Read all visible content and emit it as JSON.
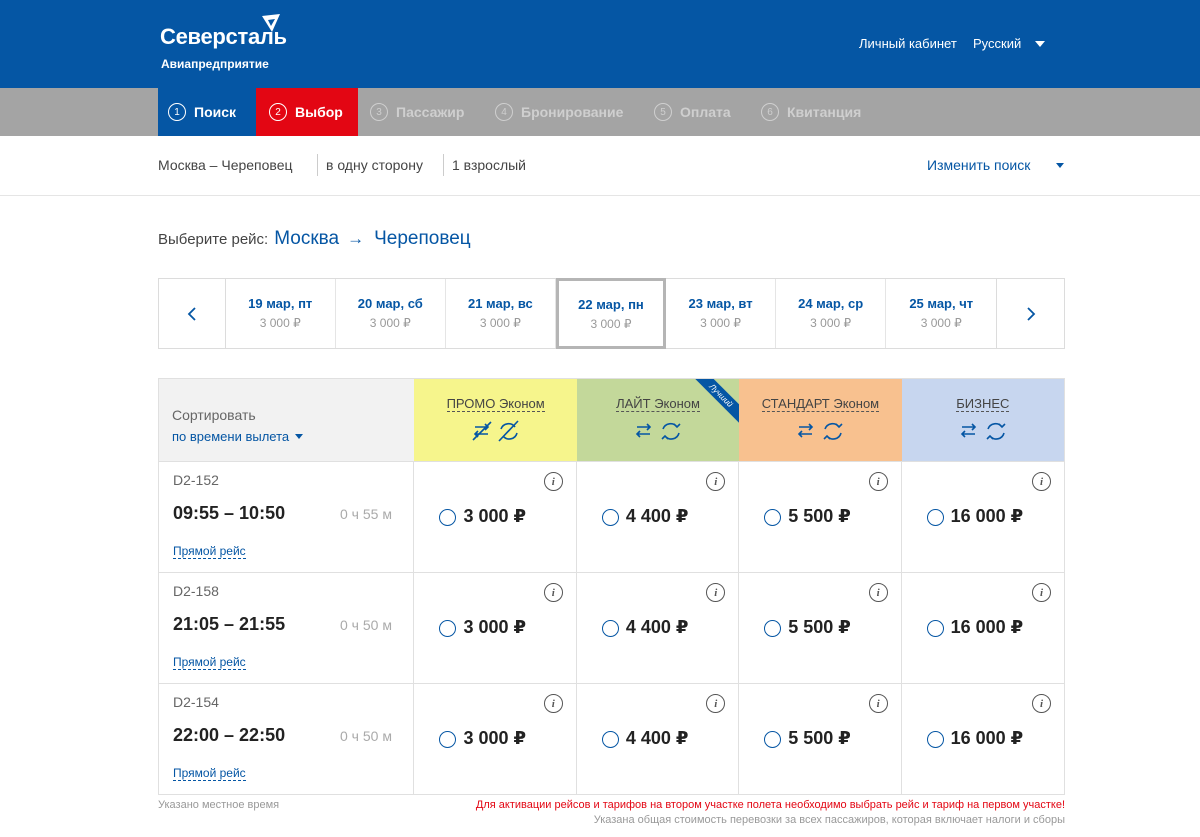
{
  "header": {
    "brand": "Северсталь",
    "subbrand": "Авиапредприятие",
    "account": "Личный кабинет",
    "language": "Русский",
    "colors": {
      "header": "#0556a4",
      "active_step": "#e30613"
    }
  },
  "steps": [
    {
      "num": "1",
      "label": "Поиск",
      "state": "done"
    },
    {
      "num": "2",
      "label": "Выбор",
      "state": "active"
    },
    {
      "num": "3",
      "label": "Пассажир",
      "state": "pending"
    },
    {
      "num": "4",
      "label": "Бронирование",
      "state": "pending"
    },
    {
      "num": "5",
      "label": "Оплата",
      "state": "pending"
    },
    {
      "num": "6",
      "label": "Квитанция",
      "state": "pending"
    }
  ],
  "summary": {
    "route": "Москва – Череповец",
    "trip_type": "в одну сторону",
    "passengers": "1 взрослый",
    "change": "Изменить поиск"
  },
  "choose": {
    "label": "Выберите рейс:",
    "from": "Москва",
    "arrow": "→",
    "to": "Череповец"
  },
  "dates": [
    {
      "date": "19 мар, пт",
      "price": "3 000 ₽"
    },
    {
      "date": "20 мар, сб",
      "price": "3 000 ₽"
    },
    {
      "date": "21 мар, вс",
      "price": "3 000 ₽"
    },
    {
      "date": "22 мар, пн",
      "price": "3 000 ₽",
      "selected": true
    },
    {
      "date": "23 мар, вт",
      "price": "3 000 ₽"
    },
    {
      "date": "24 мар, ср",
      "price": "3 000 ₽"
    },
    {
      "date": "25 мар, чт",
      "price": "3 000 ₽"
    }
  ],
  "sort": {
    "label": "Сортировать",
    "value": "по времени вылета"
  },
  "fares": [
    {
      "name": "ПРОМО Эконом",
      "color": "#f6f58c",
      "icon": "no-refund-no-exchange-icon"
    },
    {
      "name": "ЛАЙТ Эконом",
      "color": "#c3d89a",
      "icon": "refund-exchange-icon",
      "badge": "Лучший"
    },
    {
      "name": "СТАНДАРТ Эконом",
      "color": "#f8c18f",
      "icon": "refund-exchange-icon"
    },
    {
      "name": "БИЗНЕС",
      "color": "#c7d6ef",
      "icon": "refund-exchange-icon"
    }
  ],
  "flights": [
    {
      "code": "D2-152",
      "time": "09:55 – 10:50",
      "duration": "0 ч 55 м",
      "type": "Прямой рейс",
      "prices": [
        "3 000 ₽",
        "4 400 ₽",
        "5 500 ₽",
        "16 000 ₽"
      ]
    },
    {
      "code": "D2-158",
      "time": "21:05 – 21:55",
      "duration": "0 ч 50 м",
      "type": "Прямой рейс",
      "prices": [
        "3 000 ₽",
        "4 400 ₽",
        "5 500 ₽",
        "16 000 ₽"
      ]
    },
    {
      "code": "D2-154",
      "time": "22:00 – 22:50",
      "duration": "0 ч 50 м",
      "type": "Прямой рейс",
      "prices": [
        "3 000 ₽",
        "4 400 ₽",
        "5 500 ₽",
        "16 000 ₽"
      ]
    }
  ],
  "notes": {
    "local_time": "Указано местное время",
    "warning": "Для активации рейсов и тарифов на втором участке полета необходимо выбрать рейс и тариф на первом участке!",
    "total": "Указана общая стоимость перевозки за всех пассажиров, которая включает налоги и сборы"
  }
}
